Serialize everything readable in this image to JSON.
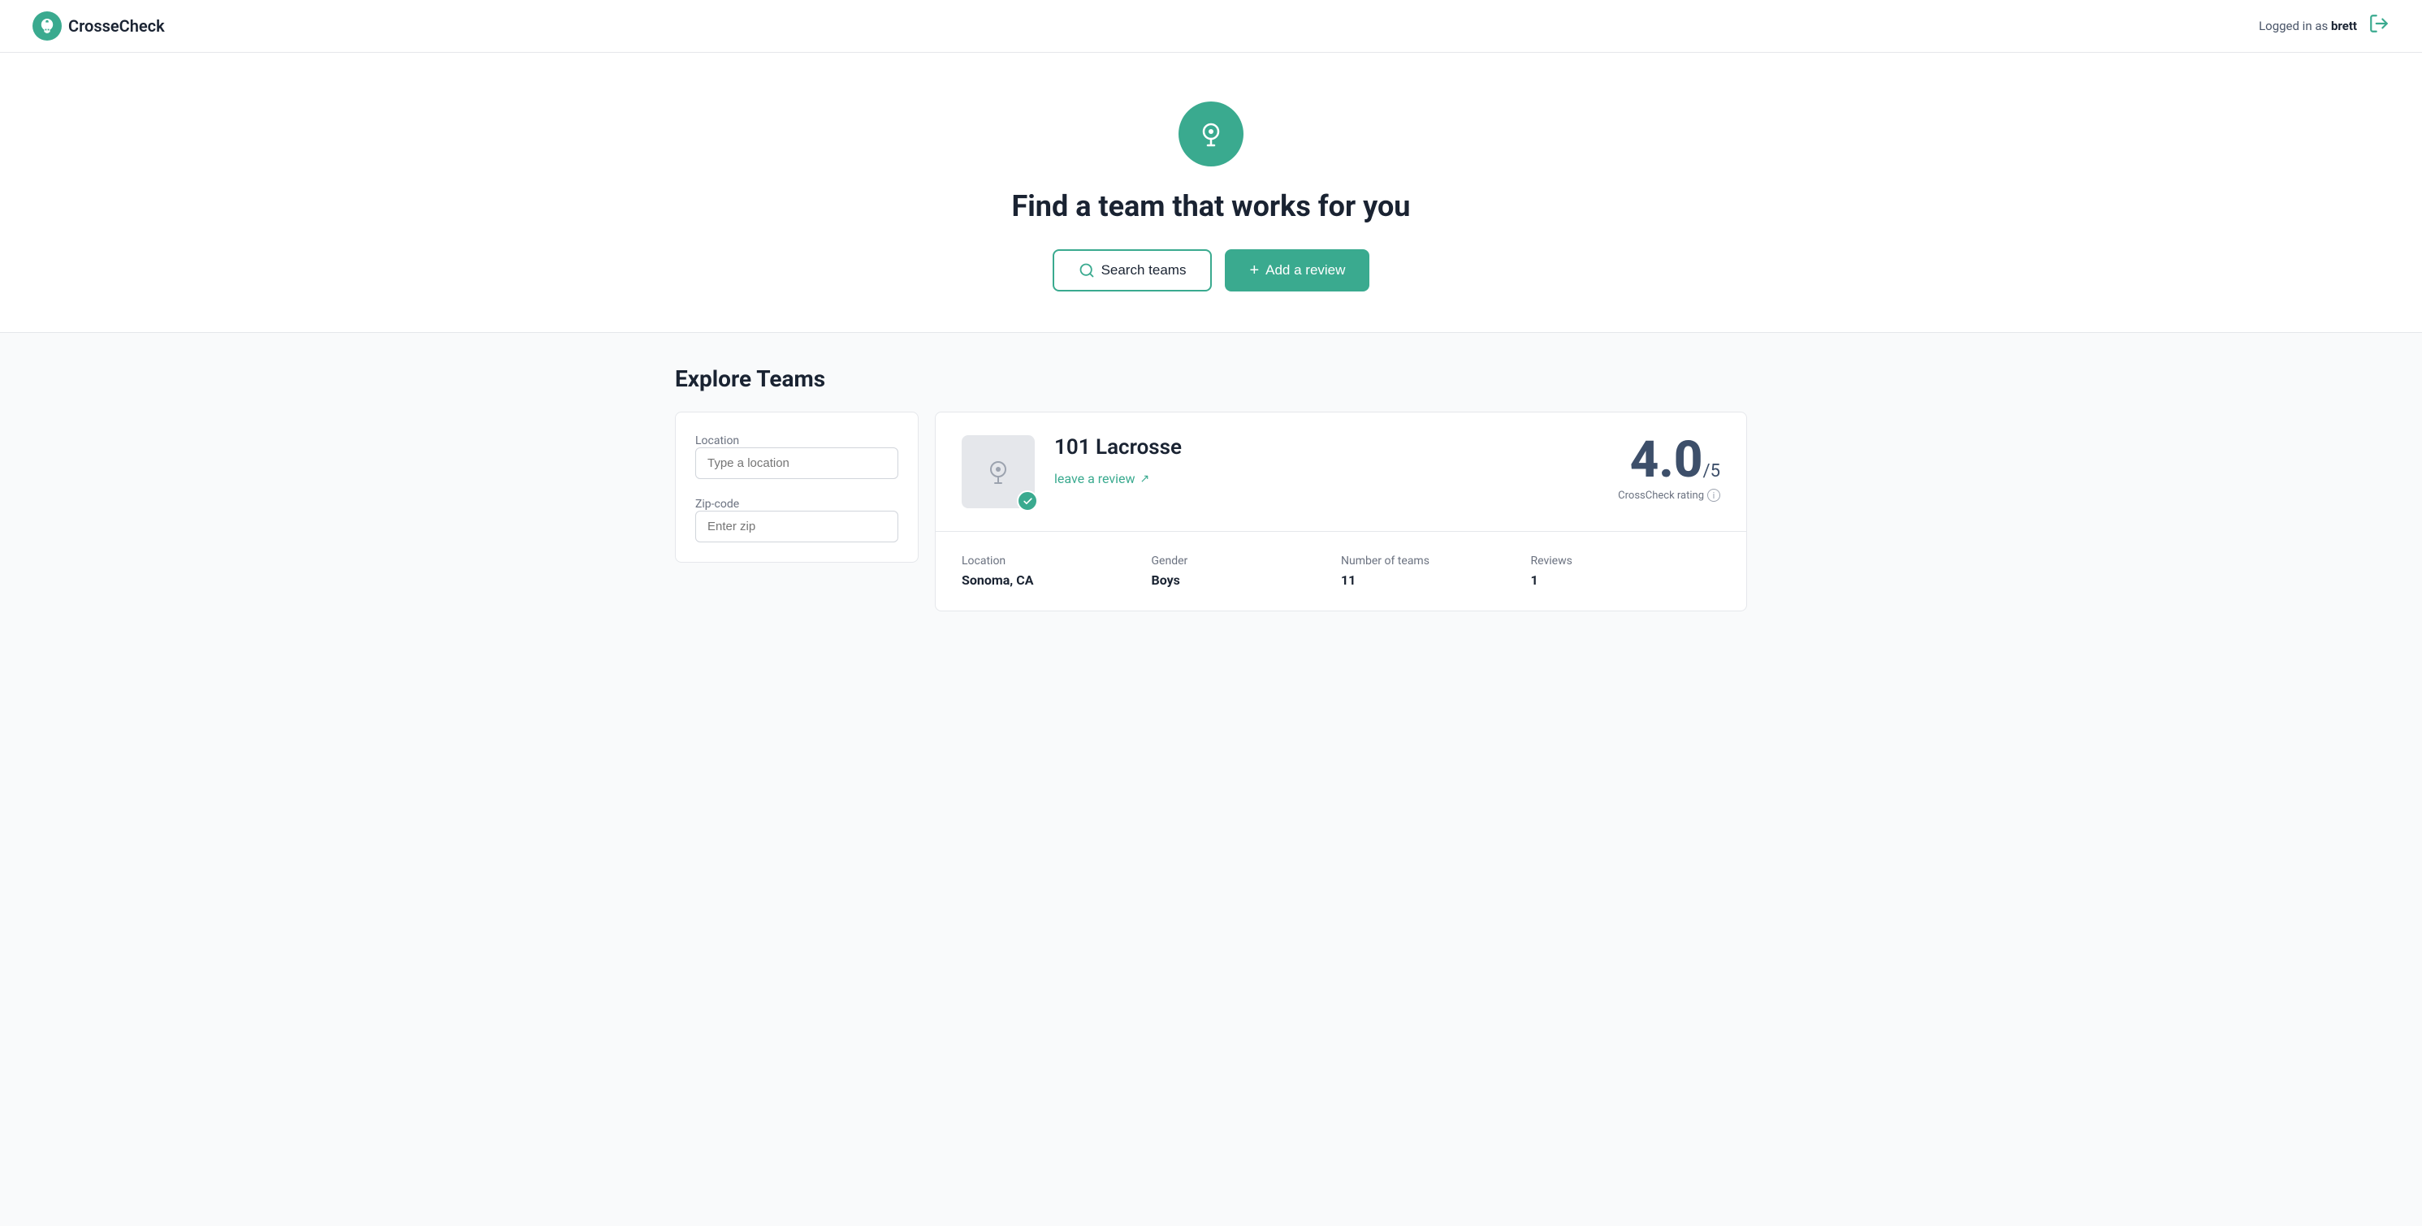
{
  "header": {
    "logo_text": "CrosseCheck",
    "logged_in_prefix": "Logged in as ",
    "logged_in_user": "brett"
  },
  "hero": {
    "title": "Find a team that works for you",
    "search_button": "Search teams",
    "add_review_button": "Add a review"
  },
  "explore": {
    "section_title": "Explore Teams"
  },
  "filters": {
    "location_label": "Location",
    "location_placeholder": "Type a location",
    "zip_label": "Zip-code",
    "zip_placeholder": "Enter zip"
  },
  "team": {
    "name": "101 Lacrosse",
    "rating": "4.0",
    "rating_denom": "/5",
    "rating_label": "CrossCheck rating",
    "leave_review": "leave a review",
    "details": [
      {
        "label": "Location",
        "value": "Sonoma, CA"
      },
      {
        "label": "Gender",
        "value": "Boys"
      },
      {
        "label": "Number of teams",
        "value": "11"
      },
      {
        "label": "Reviews",
        "value": "1"
      }
    ]
  }
}
